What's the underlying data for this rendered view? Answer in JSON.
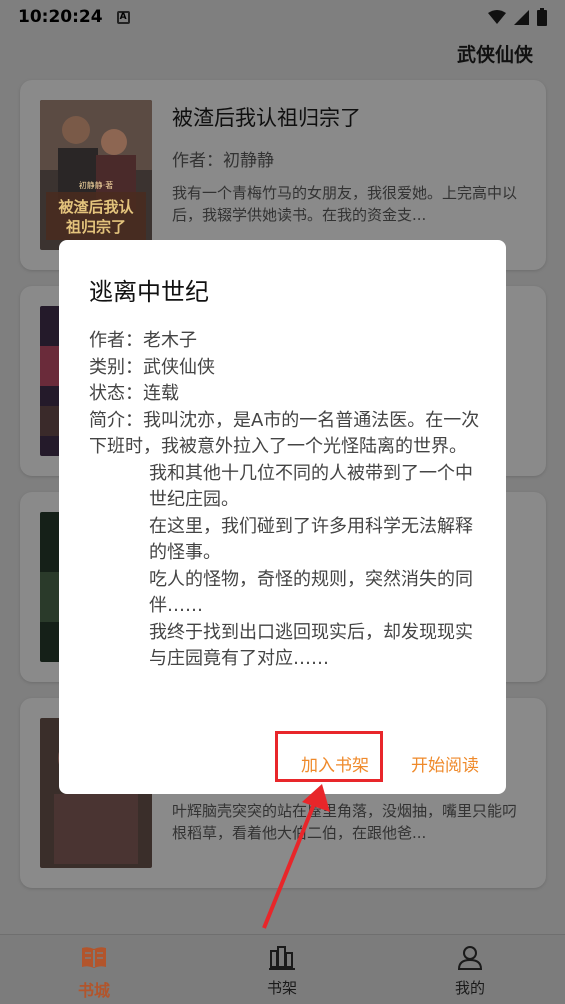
{
  "status": {
    "time": "10:20:24",
    "app_icon": "A"
  },
  "header": {
    "category": "武侠仙侠"
  },
  "books": [
    {
      "title": "被渣后我认祖归宗了",
      "author": "作者：初静静",
      "desc": "我有一个青梅竹马的女朋友，我很爱她。上完高中以后，我辍学供她读书。在我的资金支...",
      "cover_text": "被渣后我认祖归宗了",
      "cover_tag": "初静静·著"
    },
    {
      "title": "",
      "author": "",
      "desc": ""
    },
    {
      "title": "",
      "author": "",
      "desc": ""
    },
    {
      "title": "",
      "author": "",
      "desc": "叶辉脑壳突突的站在屋里角落，没烟抽，嘴里只能叼根稻草，看着他大伯二伯，在跟他爸..."
    }
  ],
  "dialog": {
    "title": "逃离中世纪",
    "author": "作者：老木子",
    "category": "类别：武侠仙侠",
    "status": "状态：连载",
    "intro_1": "简介：我叫沈亦，是A市的一名普通法医。在一次下班时，我被意外拉入了一个光怪陆离的世界。",
    "intro_2": "我和其他十几位不同的人被带到了一个中世纪庄园。",
    "intro_3": "在这里，我们碰到了许多用科学无法解释的怪事。",
    "intro_4": "吃人的怪物，奇怪的规则，突然消失的同伴……",
    "intro_5": "我终于找到出口逃回现实后，却发现现实与庄园竟有了对应……",
    "add_shelf": "加入书架",
    "start_read": "开始阅读"
  },
  "nav": [
    {
      "label": "书城",
      "icon": "book-open-icon",
      "active": true
    },
    {
      "label": "书架",
      "icon": "bookshelf-icon",
      "active": false
    },
    {
      "label": "我的",
      "icon": "user-icon",
      "active": false
    }
  ],
  "colors": {
    "accent": "#ef8a2b",
    "highlight": "#e8262a",
    "nav_active": "#b2552c"
  }
}
